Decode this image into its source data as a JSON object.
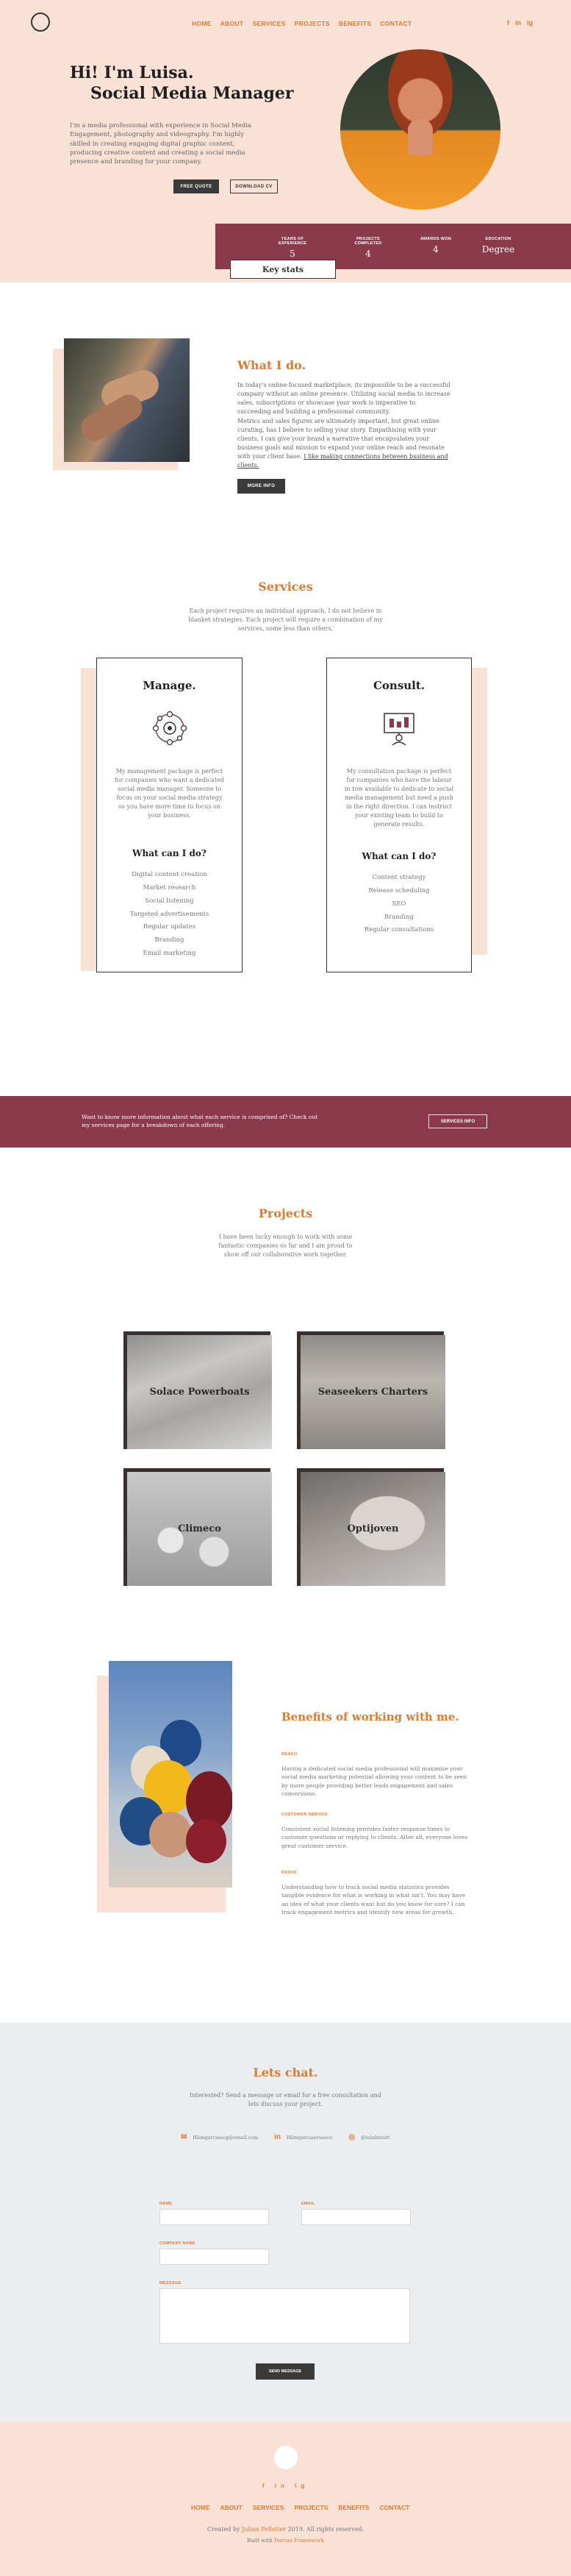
{
  "nav": {
    "items": [
      "HOME",
      "ABOUT",
      "SERVICES",
      "PROJECTS",
      "BENEFITS",
      "CONTACT"
    ],
    "social": [
      "f",
      "in",
      "ig"
    ]
  },
  "hero": {
    "title_line1": "Hi! I'm Luisa.",
    "title_line2": "Social Media Manager",
    "description": "I'm a media professional with experience in Social Media Engagement, photography and videography. I'm highly skilled in creating engaging digital graphic content, producing creative content and creating a social media presence and branding for your company.",
    "btn_quote": "FREE QUOTE",
    "btn_download": "DOWNLOAD CV"
  },
  "stats": {
    "items": [
      {
        "label": "YEARS OF EXPERIENCE",
        "value": "5"
      },
      {
        "label": "PROJECTS COMPLETED",
        "value": "4"
      },
      {
        "label": "AWARDS WON",
        "value": "4"
      },
      {
        "label": "EDUCATION",
        "value": "Degree"
      }
    ],
    "key_stats_label": "Key stats"
  },
  "what_i_do": {
    "title": "What I do.",
    "p1": "In today's online-focused marketplace, its impossible to be a successful company without an online presence. Utilizing social media to increase sales, subscriptions or showcase your work is imperative to succeeding and building a professional community.",
    "p2_main": "Metrics and sales figures are ultimately important, but great online curating, has I believe to selling your story. Empathising with your clients, I can give your brand a narrative that encapsulates your business goals and mission to expand your online reach and resonate with your client base.",
    "p2_link": "I like making connections between business and clients.",
    "btn": "MORE INFO"
  },
  "services": {
    "title": "Services",
    "subtitle": "Each project requires an individual approach, I do not believe in blanket strategies. Each project will require a combination of my services, some less than others.",
    "cards": [
      {
        "title": "Manage.",
        "icon": "network-gear-icon",
        "desc": "My management package is perfect for companies who want a dedicated social media manager. Someone to focus on your social media strategy so you have more time to focus on your business.",
        "what_title": "What can I do?",
        "items": [
          "Digital content creation",
          "Market research",
          "Social listening",
          "Targeted advertisements",
          "Regular updates",
          "Branding",
          "Email marketing"
        ]
      },
      {
        "title": "Consult.",
        "icon": "presentation-board-icon",
        "desc": "My consultation package is perfect for companies who have the labour in tow available to dedicate to social media management but need a push in the right direction. I can instruct your existing team to build to generate results.",
        "what_title": "What can I do?",
        "items": [
          "Content strategy",
          "Release scheduling",
          "SEO",
          "Branding",
          "Regular consultations"
        ]
      }
    ]
  },
  "cta": {
    "text": "Want to know more information about what each service is comprised of? Check out my services page for a breakdown of each offering.",
    "btn": "SERVICES INFO"
  },
  "projects": {
    "title": "Projects",
    "subtitle": "I have been lucky enough to work with some fantastic companies so far and I am proud to show off our collaborative work together.",
    "items": [
      "Solace Powerboats",
      "Seaseekers Charters",
      "Climeco",
      "Optijoven"
    ]
  },
  "benefits": {
    "title": "Benefits of working with me.",
    "sections": [
      {
        "heading": "REACH",
        "text": "Having a dedicated social media professional will maximise your social media marketing potential allowing your content to be seen by more people providing better leads engagement and sales conversions."
      },
      {
        "heading": "CUSTOMER SERVICE",
        "text": "Consistent social listening provides faster response times to customer questions or replying to clients. After all, everyone loves great customer service."
      },
      {
        "heading": "PROOF",
        "text": "Understanding how to track social media statistics provides tangible evidence for what is working in what isn't. You may have an idea of what your clients want but do you know for sure? I can track engagement metrics and identify new areas for growth."
      }
    ]
  },
  "contact": {
    "title": "Lets chat.",
    "subtitle": "Interested? Send a message or email for a free consultation and lets discuss your project.",
    "email": "Hiimgarciaecg@email.com",
    "linkedin": "Hiimgarciaorsaeco",
    "instagram": "@iuiuhtnutt",
    "fields": {
      "name": "NAME",
      "email": "EMAIL",
      "company": "COMPANY NAME",
      "message": "MESSAGE"
    },
    "btn": "SEND MESSAGE"
  },
  "footer": {
    "credit_prefix": "Created by",
    "credit_name": "Julian Pelletier",
    "credit_suffix": "2019. All rights reserved.",
    "built_prefix": "Built with",
    "built_name": "Dorcas Framework"
  },
  "colors": {
    "accent": "#e07b2f",
    "peach": "#f9e1d6",
    "maroon": "#8a3a4b",
    "dark": "#3a3a3a"
  }
}
